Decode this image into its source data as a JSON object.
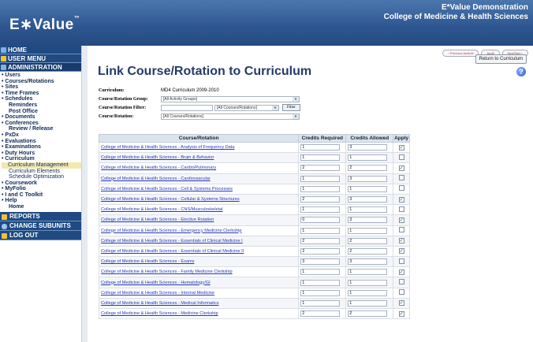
{
  "header": {
    "logo": "E∗Value",
    "logo_tm": "™",
    "org_line1": "E*Value Demonstration",
    "org_line2": "College of Medicine & Health Sciences"
  },
  "sidebar": {
    "home": "HOME",
    "user_menu": "USER MENU",
    "administration": "ADMINISTRATION",
    "items": [
      {
        "label": "• Users",
        "type": "item"
      },
      {
        "label": "• Courses/Rotations",
        "type": "item"
      },
      {
        "label": "• Sites",
        "type": "item"
      },
      {
        "label": "• Time Frames",
        "type": "item"
      },
      {
        "label": "• Schedules",
        "type": "item"
      },
      {
        "label": "Reminders",
        "type": "sub"
      },
      {
        "label": "Post Office",
        "type": "sub"
      },
      {
        "label": "• Documents",
        "type": "item"
      },
      {
        "label": "• Conferences",
        "type": "item"
      },
      {
        "label": "Review / Release",
        "type": "sub"
      },
      {
        "label": "• PxDx",
        "type": "item"
      },
      {
        "label": "• Evaluations",
        "type": "item"
      },
      {
        "label": "• Examinations",
        "type": "item"
      },
      {
        "label": "• Duty Hours",
        "type": "item"
      },
      {
        "label": "• Curriculum",
        "type": "item"
      },
      {
        "label": "Curriculum Management",
        "type": "hl"
      },
      {
        "label": "Curriculum Elements",
        "type": "plain"
      },
      {
        "label": "Schedule Optimization",
        "type": "plain"
      },
      {
        "label": "• Coursework",
        "type": "item"
      },
      {
        "label": "• MyFolio",
        "type": "item"
      },
      {
        "label": "• I and C Toolkit",
        "type": "item"
      },
      {
        "label": "• Help",
        "type": "item"
      },
      {
        "label": "Home",
        "type": "sub"
      }
    ],
    "reports": "REPORTS",
    "change_subunits": "CHANGE SUBUNITS",
    "log_out": "LOG OUT"
  },
  "main": {
    "top_link_1": "‹ Previous AudioN",
    "top_link_2": "Audit",
    "top_link_3": "NextTime ›",
    "return_button": "Return to Curriculum",
    "help_icon": "?",
    "title": "Link Course/Rotation to Curriculum",
    "form": {
      "curriculum_label": "Curriculum:",
      "curriculum_value": "MD4 Curriculum 2009-2010",
      "group_label": "Course/Rotation Group:",
      "group_value": "[All Activity Groups]",
      "filter_label": "Course/Rotation Filter:",
      "filter_select_value": "[All Courses/Rotations]",
      "filter_button": "Filter",
      "rotation_label": "Course/Rotation:",
      "rotation_value": "[All Courses/Rotations]"
    },
    "table": {
      "headers": [
        "Course/Rotation",
        "Credits Required",
        "Credits Allowed",
        "Apply"
      ],
      "rows": [
        {
          "name": "College of Medicine & Health Sciences - Analysis of Frequency Data",
          "required": "1",
          "allowed": "3",
          "apply": true
        },
        {
          "name": "College of Medicine & Health Sciences - Brain & Behavior",
          "required": "1",
          "allowed": "1",
          "apply": false
        },
        {
          "name": "College of Medicine & Health Sciences - Cardio/Pulmonary",
          "required": "2",
          "allowed": "2",
          "apply": true
        },
        {
          "name": "College of Medicine & Health Sciences - Cardiovascular",
          "required": "1",
          "allowed": "3",
          "apply": false
        },
        {
          "name": "College of Medicine & Health Sciences - Cell & Systems Processes",
          "required": "1",
          "allowed": "1",
          "apply": false
        },
        {
          "name": "College of Medicine & Health Sciences - Cellular & Systems Structures",
          "required": "2",
          "allowed": "3",
          "apply": true
        },
        {
          "name": "College of Medicine & Health Sciences - CNS/Musculoskeletal",
          "required": "1",
          "allowed": "1",
          "apply": false
        },
        {
          "name": "College of Medicine & Health Sciences - Elective Rotation",
          "required": "0",
          "allowed": "3",
          "apply": true
        },
        {
          "name": "College of Medicine & Health Sciences - Emergency Medicine Clerkship",
          "required": "1",
          "allowed": "1",
          "apply": false
        },
        {
          "name": "College of Medicine & Health Sciences - Essentials of Clinical Medicine I",
          "required": "2",
          "allowed": "2",
          "apply": true
        },
        {
          "name": "College of Medicine & Health Sciences - Essentials of Clinical Medicine II",
          "required": "2",
          "allowed": "2",
          "apply": true
        },
        {
          "name": "College of Medicine & Health Sciences - Exams",
          "required": "3",
          "allowed": "3",
          "apply": false
        },
        {
          "name": "College of Medicine & Health Sciences - Family Medicine Clerkship",
          "required": "1",
          "allowed": "1",
          "apply": true
        },
        {
          "name": "College of Medicine & Health Sciences - Hematology/GI",
          "required": "1",
          "allowed": "1",
          "apply": false
        },
        {
          "name": "College of Medicine & Health Sciences - Internal Medicine",
          "required": "1",
          "allowed": "1",
          "apply": false
        },
        {
          "name": "College of Medicine & Health Sciences - Medical Informatics",
          "required": "1",
          "allowed": "1",
          "apply": true
        },
        {
          "name": "College of Medicine & Health Sciences - Medicine Clerkship",
          "required": "2",
          "allowed": "2",
          "apply": true
        }
      ]
    }
  },
  "colors": {
    "header": "#2d5690",
    "nav": "#1f4a82",
    "link": "#2538b5",
    "title": "#243a6a"
  },
  "icons": [
    "home-icon",
    "user-menu-icon",
    "administration-icon",
    "reports-icon",
    "change-subunits-icon",
    "log-out-icon",
    "help-icon",
    "checkbox-check-icon"
  ]
}
